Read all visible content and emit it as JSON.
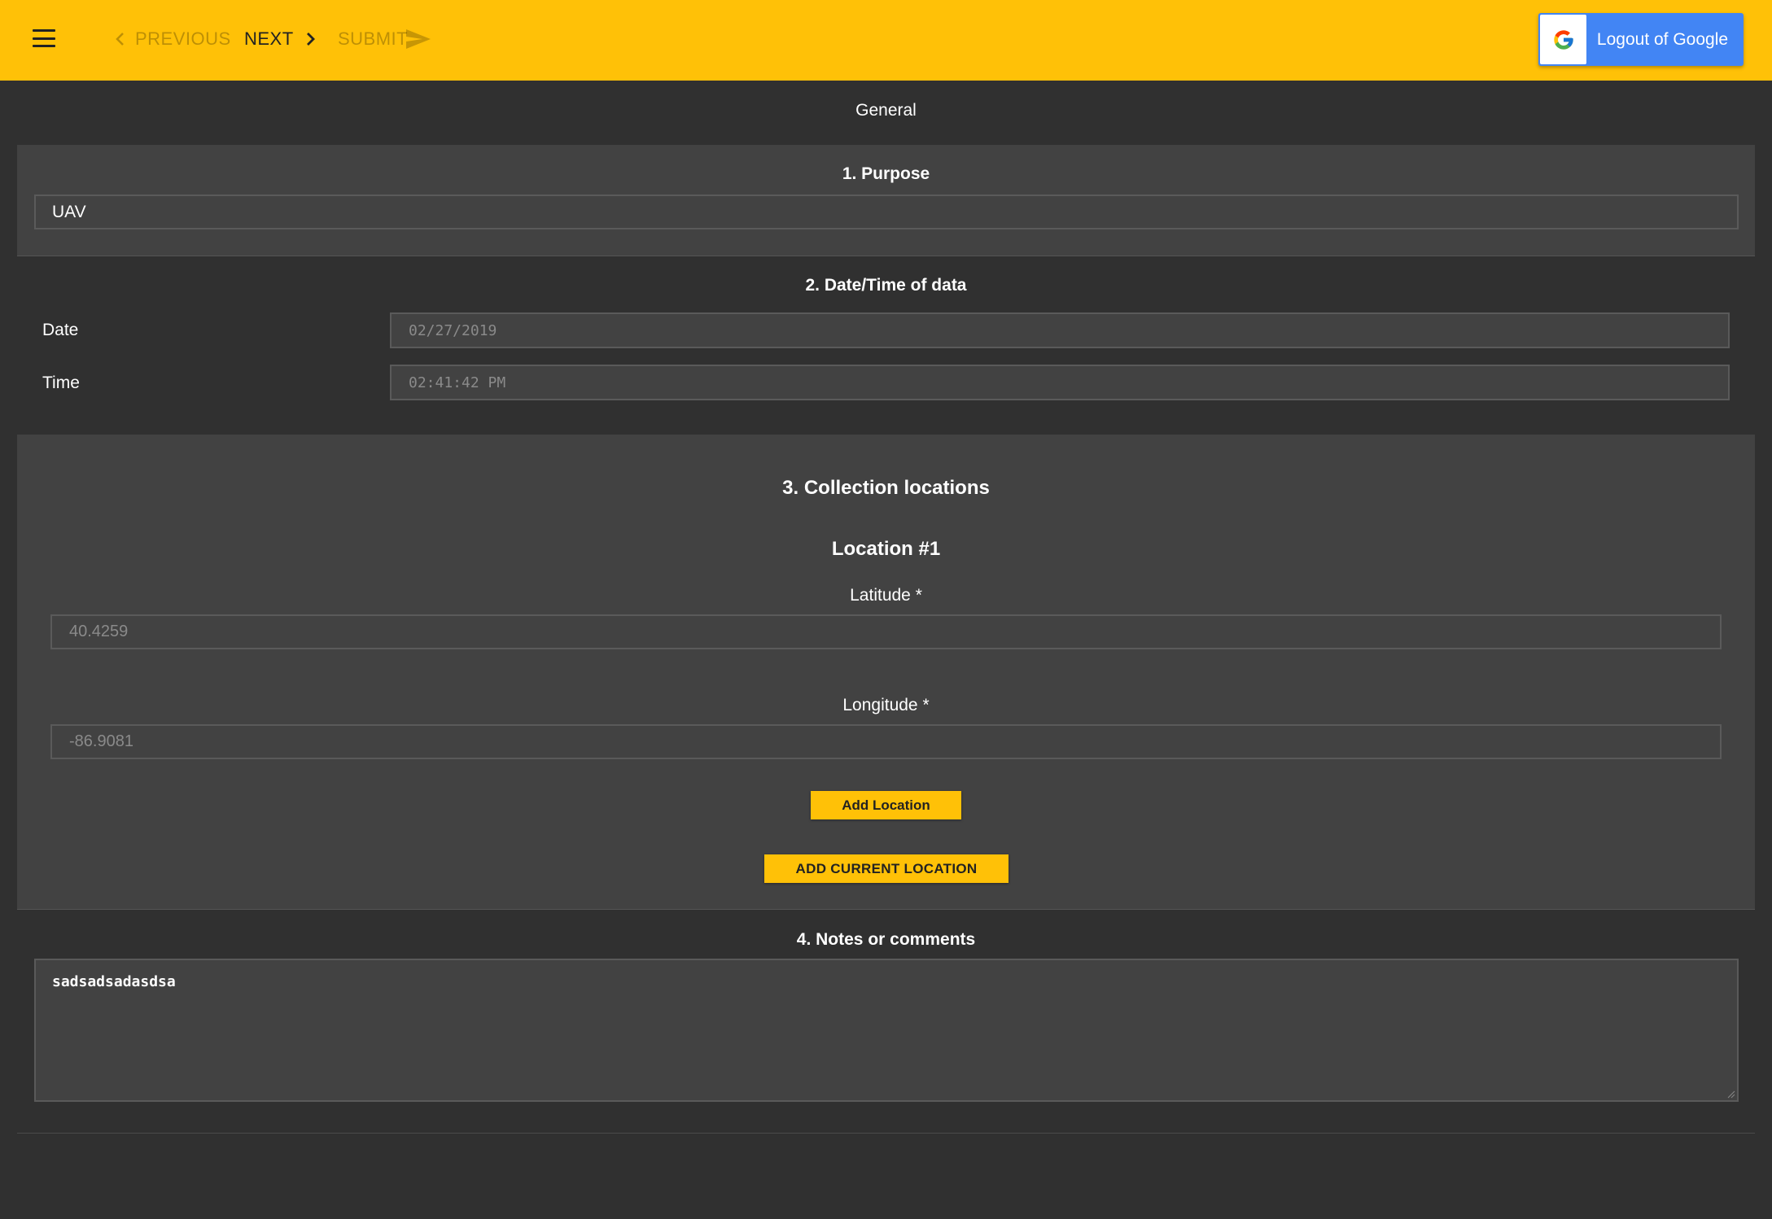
{
  "toolbar": {
    "prev_label": "PREVIOUS",
    "next_label": "NEXT",
    "submit_label": "SUBMIT",
    "google_label": "Logout of Google",
    "accent": "#ffc107",
    "google_blue": "#4285f4"
  },
  "page_title": "General",
  "purpose": {
    "title": "1. Purpose",
    "value": "UAV"
  },
  "datetime": {
    "title": "2. Date/Time of data",
    "date_label": "Date",
    "date_value": "02/27/2019",
    "time_label": "Time",
    "time_value": "02:41:42 PM"
  },
  "locations": {
    "title": "3. Collection locations",
    "location_title": "Location #1",
    "latitude_label": "Latitude *",
    "latitude_value": "40.4259",
    "longitude_label": "Longitude *",
    "longitude_value": "-86.9081",
    "add_location_label": "Add Location",
    "add_current_label": "ADD CURRENT LOCATION"
  },
  "notes": {
    "title": "4. Notes or comments",
    "value": "sadsadsadasdsa"
  }
}
